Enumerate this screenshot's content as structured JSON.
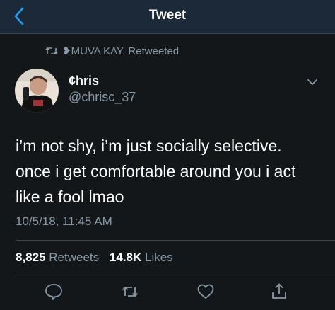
{
  "nav": {
    "title": "Tweet",
    "back_icon": "chevron-left-icon"
  },
  "retweet_context": {
    "icon": "retweet-icon",
    "text": "❥MUVA KAY. Retweeted"
  },
  "author": {
    "display_name": "¢hris",
    "handle": "@chrisc_37",
    "avatar": "profile-photo"
  },
  "tweet": {
    "lines": [
      "i’m not shy, i’m just socially selective.",
      "once i get comfortable around you i act",
      "like a fool lmao"
    ],
    "timestamp": "10/5/18, 11:45 AM"
  },
  "stats": {
    "retweets_count": "8,825",
    "retweets_label": "Retweets",
    "likes_count": "14.8K",
    "likes_label": "Likes"
  },
  "actions": [
    "reply-icon",
    "retweet-icon",
    "like-icon",
    "share-icon"
  ],
  "colors": {
    "background": "#14171a",
    "navbar": "#1c2938",
    "accent": "#1da1f2",
    "secondary_text": "#8899a6",
    "divider": "#38444d"
  }
}
